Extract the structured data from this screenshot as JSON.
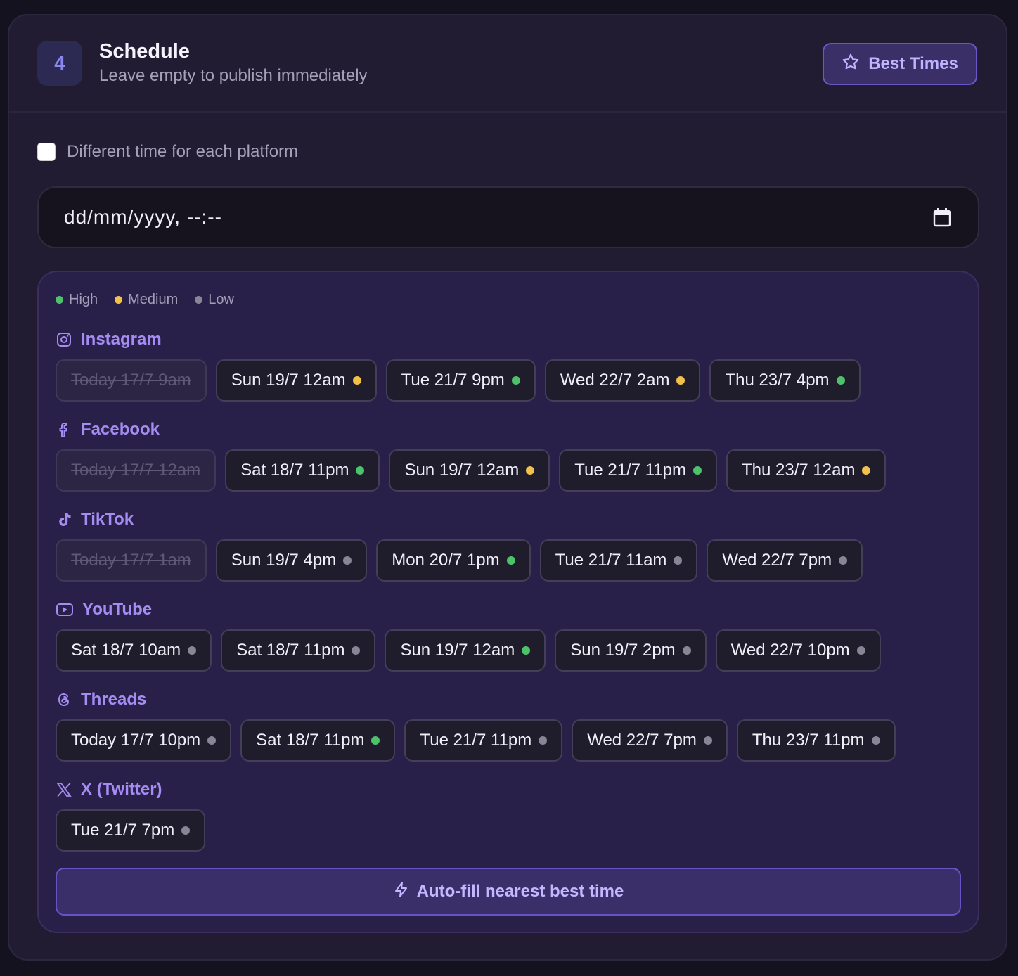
{
  "header": {
    "step": "4",
    "title": "Schedule",
    "subtitle": "Leave empty to publish immediately",
    "best_times_label": "Best Times"
  },
  "options": {
    "different_time_label": "Different time for each platform",
    "different_time_checked": false
  },
  "datetime_input": {
    "placeholder": "dd/mm/yyyy, --:--",
    "value": ""
  },
  "legend": [
    {
      "label": "High",
      "color": "#4ec26a"
    },
    {
      "label": "Medium",
      "color": "#f2c14a"
    },
    {
      "label": "Low",
      "color": "#8a8596"
    }
  ],
  "platforms": [
    {
      "name": "Instagram",
      "icon": "instagram-icon",
      "slots": [
        {
          "label": "Today 17/7 9am",
          "level": "past"
        },
        {
          "label": "Sun 19/7 12am",
          "level": "medium"
        },
        {
          "label": "Tue 21/7 9pm",
          "level": "high"
        },
        {
          "label": "Wed 22/7 2am",
          "level": "medium"
        },
        {
          "label": "Thu 23/7 4pm",
          "level": "high"
        }
      ]
    },
    {
      "name": "Facebook",
      "icon": "facebook-icon",
      "slots": [
        {
          "label": "Today 17/7 12am",
          "level": "past"
        },
        {
          "label": "Sat 18/7 11pm",
          "level": "high"
        },
        {
          "label": "Sun 19/7 12am",
          "level": "medium"
        },
        {
          "label": "Tue 21/7 11pm",
          "level": "high"
        },
        {
          "label": "Thu 23/7 12am",
          "level": "medium"
        }
      ]
    },
    {
      "name": "TikTok",
      "icon": "tiktok-icon",
      "slots": [
        {
          "label": "Today 17/7 1am",
          "level": "past"
        },
        {
          "label": "Sun 19/7 4pm",
          "level": "low"
        },
        {
          "label": "Mon 20/7 1pm",
          "level": "high"
        },
        {
          "label": "Tue 21/7 11am",
          "level": "low"
        },
        {
          "label": "Wed 22/7 7pm",
          "level": "low"
        }
      ]
    },
    {
      "name": "YouTube",
      "icon": "youtube-icon",
      "slots": [
        {
          "label": "Sat 18/7 10am",
          "level": "low"
        },
        {
          "label": "Sat 18/7 11pm",
          "level": "low"
        },
        {
          "label": "Sun 19/7 12am",
          "level": "high"
        },
        {
          "label": "Sun 19/7 2pm",
          "level": "low"
        },
        {
          "label": "Wed 22/7 10pm",
          "level": "low"
        }
      ]
    },
    {
      "name": "Threads",
      "icon": "threads-icon",
      "slots": [
        {
          "label": "Today 17/7 10pm",
          "level": "low"
        },
        {
          "label": "Sat 18/7 11pm",
          "level": "high"
        },
        {
          "label": "Tue 21/7 11pm",
          "level": "low"
        },
        {
          "label": "Wed 22/7 7pm",
          "level": "low"
        },
        {
          "label": "Thu 23/7 11pm",
          "level": "low"
        }
      ]
    },
    {
      "name": "X (Twitter)",
      "icon": "x-twitter-icon",
      "slots": [
        {
          "label": "Tue 21/7 7pm",
          "level": "low"
        }
      ]
    }
  ],
  "autofill_label": "Auto-fill nearest best time",
  "colors": {
    "accent": "#a48cf2",
    "high": "#4ec26a",
    "medium": "#f2c14a",
    "low": "#8a8596"
  }
}
